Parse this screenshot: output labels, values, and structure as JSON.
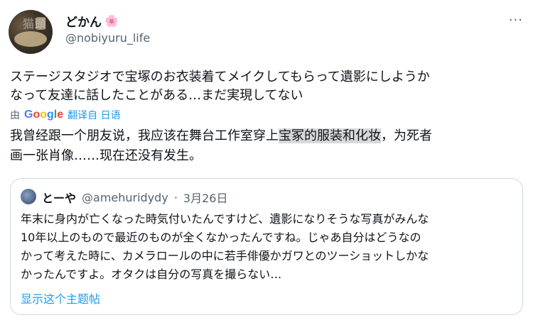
{
  "author": {
    "display_name": "どかん",
    "emoji": "🌸",
    "handle": "@nobiyuru_life",
    "avatar_watermark": "猫頭"
  },
  "more_menu": "···",
  "tweet": {
    "text_line1": "ステージスタジオで宝塚のお衣装着てメイクしてもらって遺影にしようか",
    "text_line2": "なって友達に話したことがある…まだ実現してない"
  },
  "translation": {
    "by_label": "由",
    "google_g": "G",
    "google_o1": "o",
    "google_o2": "o",
    "google_g2": "g",
    "google_l": "l",
    "google_e": "e",
    "translated_from": "翻译自 日语",
    "line1_pre": "我曾经跟一个朋友说，我应该在舞台工作室穿上",
    "line1_hl": "宝冢的服装和化妆",
    "line1_post": "，为死者",
    "line2": "画一张肖像……现在还没有发生。"
  },
  "quote": {
    "name": "とーや",
    "handle": "@amehuridydy",
    "separator": "·",
    "date": "3月26日",
    "line1": "年末に身内が亡くなった時気付いたんですけど、遺影になりそうな写真がみんな",
    "line2": "10年以上のもので最近のものが全くなかったんですね。じゃあ自分はどうなの",
    "line3": "かって考えた時に、カメラロールの中に若手俳優かガワとのツーショットしかな",
    "line4": "かったんですよ。オタクは自分の写真を撮らない…",
    "show_thread": "显示这个主题帖"
  }
}
